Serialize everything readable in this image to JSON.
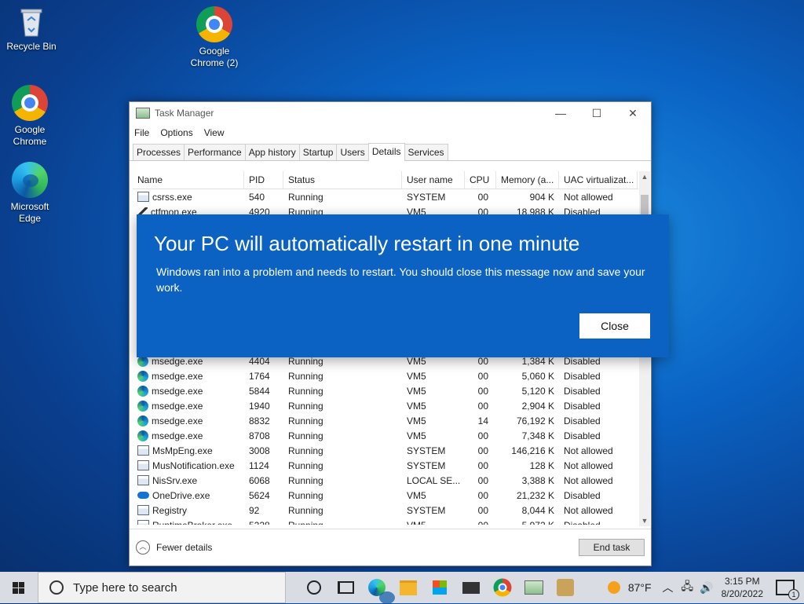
{
  "desktop": {
    "icons": [
      {
        "label": "Recycle Bin",
        "icon": "recycle-bin-icon"
      },
      {
        "label": "Google Chrome (2)",
        "icon": "chrome-icon"
      },
      {
        "label": "Google Chrome",
        "icon": "chrome-icon"
      },
      {
        "label": "Microsoft Edge",
        "icon": "edge-icon"
      }
    ]
  },
  "task_manager": {
    "title": "Task Manager",
    "window_controls": {
      "minimize": "—",
      "maximize": "☐",
      "close": "✕"
    },
    "menu": [
      "File",
      "Options",
      "View"
    ],
    "tabs": [
      "Processes",
      "Performance",
      "App history",
      "Startup",
      "Users",
      "Details",
      "Services"
    ],
    "active_tab": "Details",
    "columns": [
      "Name",
      "PID",
      "Status",
      "User name",
      "CPU",
      "Memory (a...",
      "UAC virtualizat..."
    ],
    "rows": [
      {
        "name": "csrss.exe",
        "pid": "540",
        "status": "Running",
        "user": "SYSTEM",
        "cpu": "00",
        "mem": "904 K",
        "uac": "Not allowed",
        "icon": "generic"
      },
      {
        "name": "ctfmon.exe",
        "pid": "4920",
        "status": "Running",
        "user": "VM5",
        "cpu": "00",
        "mem": "18,988 K",
        "uac": "Disabled",
        "icon": "pen"
      },
      {
        "name": "",
        "pid": "",
        "status": "",
        "user": "",
        "cpu": "",
        "mem": "",
        "uac": "",
        "icon": "none"
      },
      {
        "name": "",
        "pid": "",
        "status": "",
        "user": "",
        "cpu": "",
        "mem": "",
        "uac": "",
        "icon": "none"
      },
      {
        "name": "",
        "pid": "",
        "status": "",
        "user": "",
        "cpu": "",
        "mem": "",
        "uac": "",
        "icon": "none"
      },
      {
        "name": "",
        "pid": "",
        "status": "",
        "user": "",
        "cpu": "",
        "mem": "",
        "uac": "",
        "icon": "none"
      },
      {
        "name": "",
        "pid": "",
        "status": "",
        "user": "",
        "cpu": "",
        "mem": "",
        "uac": "",
        "icon": "none"
      },
      {
        "name": "",
        "pid": "",
        "status": "",
        "user": "",
        "cpu": "",
        "mem": "",
        "uac": "",
        "icon": "none"
      },
      {
        "name": "",
        "pid": "",
        "status": "",
        "user": "",
        "cpu": "",
        "mem": "",
        "uac": "",
        "icon": "none"
      },
      {
        "name": "",
        "pid": "",
        "status": "",
        "user": "",
        "cpu": "",
        "mem": "",
        "uac": "",
        "icon": "none"
      },
      {
        "name": "",
        "pid": "",
        "status": "",
        "user": "",
        "cpu": "",
        "mem": "",
        "uac": "",
        "icon": "none"
      },
      {
        "name": "msedge.exe",
        "pid": "4404",
        "status": "Running",
        "user": "VM5",
        "cpu": "00",
        "mem": "1,384 K",
        "uac": "Disabled",
        "icon": "edge"
      },
      {
        "name": "msedge.exe",
        "pid": "1764",
        "status": "Running",
        "user": "VM5",
        "cpu": "00",
        "mem": "5,060 K",
        "uac": "Disabled",
        "icon": "edge"
      },
      {
        "name": "msedge.exe",
        "pid": "5844",
        "status": "Running",
        "user": "VM5",
        "cpu": "00",
        "mem": "5,120 K",
        "uac": "Disabled",
        "icon": "edge"
      },
      {
        "name": "msedge.exe",
        "pid": "1940",
        "status": "Running",
        "user": "VM5",
        "cpu": "00",
        "mem": "2,904 K",
        "uac": "Disabled",
        "icon": "edge"
      },
      {
        "name": "msedge.exe",
        "pid": "8832",
        "status": "Running",
        "user": "VM5",
        "cpu": "14",
        "mem": "76,192 K",
        "uac": "Disabled",
        "icon": "edge"
      },
      {
        "name": "msedge.exe",
        "pid": "8708",
        "status": "Running",
        "user": "VM5",
        "cpu": "00",
        "mem": "7,348 K",
        "uac": "Disabled",
        "icon": "edge"
      },
      {
        "name": "MsMpEng.exe",
        "pid": "3008",
        "status": "Running",
        "user": "SYSTEM",
        "cpu": "00",
        "mem": "146,216 K",
        "uac": "Not allowed",
        "icon": "generic"
      },
      {
        "name": "MusNotification.exe",
        "pid": "1124",
        "status": "Running",
        "user": "SYSTEM",
        "cpu": "00",
        "mem": "128 K",
        "uac": "Not allowed",
        "icon": "generic"
      },
      {
        "name": "NisSrv.exe",
        "pid": "6068",
        "status": "Running",
        "user": "LOCAL SE...",
        "cpu": "00",
        "mem": "3,388 K",
        "uac": "Not allowed",
        "icon": "generic"
      },
      {
        "name": "OneDrive.exe",
        "pid": "5624",
        "status": "Running",
        "user": "VM5",
        "cpu": "00",
        "mem": "21,232 K",
        "uac": "Disabled",
        "icon": "cloud"
      },
      {
        "name": "Registry",
        "pid": "92",
        "status": "Running",
        "user": "SYSTEM",
        "cpu": "00",
        "mem": "8,044 K",
        "uac": "Not allowed",
        "icon": "generic"
      },
      {
        "name": "RuntimeBroker.exe",
        "pid": "5228",
        "status": "Running",
        "user": "VM5",
        "cpu": "00",
        "mem": "5,972 K",
        "uac": "Disabled",
        "icon": "generic"
      }
    ],
    "footer": {
      "fewer_details": "Fewer details",
      "end_task": "End task"
    }
  },
  "dialog": {
    "title": "Your PC will automatically restart in one minute",
    "message": "Windows ran into a problem and needs to restart. You should close this message now and save your work.",
    "close_label": "Close",
    "color": "#0b62c3"
  },
  "taskbar": {
    "search_placeholder": "Type here to search",
    "weather": "87°F",
    "time": "3:15 PM",
    "date": "8/20/2022",
    "notification_count": "1"
  }
}
